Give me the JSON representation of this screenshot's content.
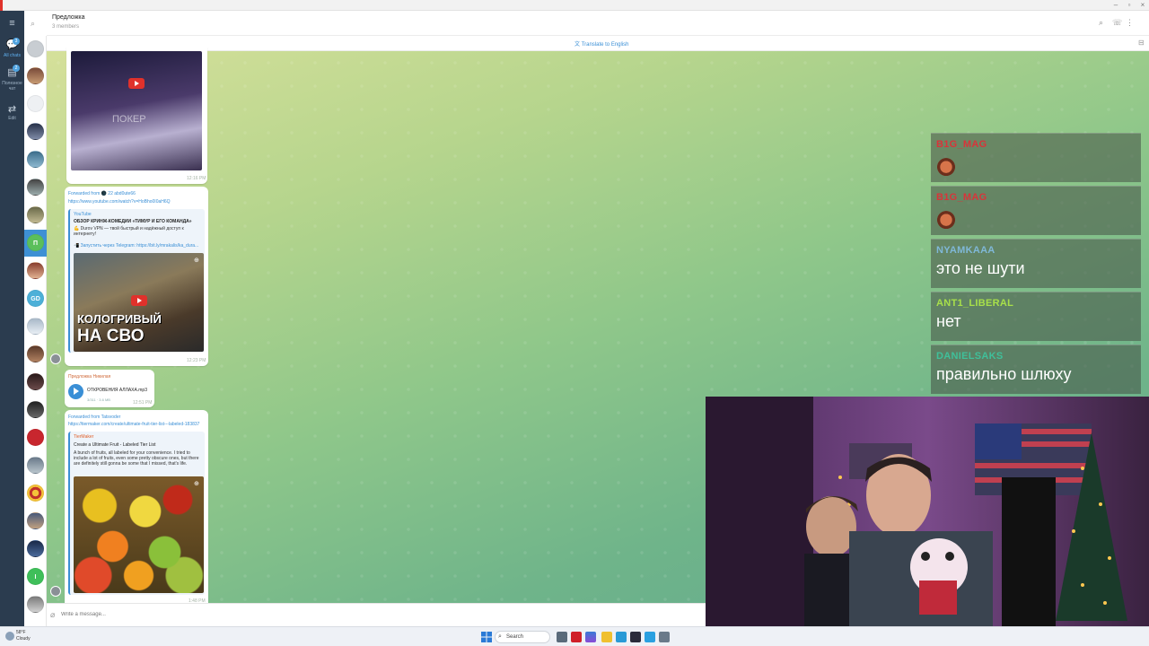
{
  "chat": {
    "title": "Предложка",
    "subtitle": "3 members",
    "translate_label": "Translate to English",
    "composer_placeholder": "Write a message..."
  },
  "folders": [
    {
      "label": "All chats",
      "badge": "3"
    },
    {
      "label": "Полезное чат",
      "badge": "2"
    },
    {
      "label": "Edit",
      "badge": ""
    }
  ],
  "chat_list_letters": [
    "П",
    "GD",
    "I"
  ],
  "messages": [
    {
      "type": "video",
      "overlay_text": "ПОКЕР",
      "time": "12:16 PM"
    },
    {
      "type": "forward_link",
      "forwarded": "Forwarded from 🌑 22 abd0ute66",
      "link": "https://www.youtube.com/watch?v=HoBho0I0aH6Q",
      "site": "YouTube",
      "title": "ОБЗОР КРИНЖ-КОМЕДИИ «ТИМУР И ЕГО КОМАНДА»",
      "text": "💪 Durov VPN — твой быстрый и надёжный доступ к интернету!",
      "text2": "📲 Запустить через Telegram: https://bit.ly/mrakalis/ka_dura...",
      "thumb_text_1": "КОЛОГРИВЫЙ",
      "thumb_text_2": "НА СВО",
      "time": "12:23 PM"
    },
    {
      "type": "audio",
      "sender": "Предложка Никилая",
      "filename": "ОТКРОВЕНИЯ АЛЛАХА.mp3",
      "meta": "3/311 · 3.6 MB",
      "time": "12:51 PM"
    },
    {
      "type": "forward_link",
      "forwarded": "Forwarded from Tatsvoder",
      "link": "https://tiermaker.com/create/ultimate-fruit-tier-list---labeled-183837",
      "site": "TierMaker",
      "title": "Create a Ultimate Fruit - Labeled Tier List",
      "text": "A bunch of fruits, all labeled for your convenience. I tried to include a lot of fruits, even some pretty obscure ones, but there are definitely still gonna be some that I missed, that's life.",
      "time": "1:48 PM"
    }
  ],
  "stream_chat": [
    {
      "user": "B1G_MAG",
      "color": "#d8343a",
      "text": "",
      "emote": "pepe-emote"
    },
    {
      "user": "B1G_MAG",
      "color": "#d8343a",
      "text": "",
      "emote": "pepe-emote"
    },
    {
      "user": "NYAMKAAA",
      "color": "#7fb8d8",
      "text": "это не шути",
      "emote": ""
    },
    {
      "user": "ANT1_LIBERAL",
      "color": "#a8e04a",
      "text": "нет",
      "emote": ""
    },
    {
      "user": "DANIELSAKS",
      "color": "#3fc09a",
      "text": "правильно шлюху",
      "emote": ""
    }
  ],
  "taskbar": {
    "weather_temp": "58°F",
    "weather_desc": "Cloudy",
    "search_label": "Search"
  },
  "icons": {
    "menu": "hamburger-icon",
    "search": "search-icon",
    "attach": "paperclip-icon"
  }
}
